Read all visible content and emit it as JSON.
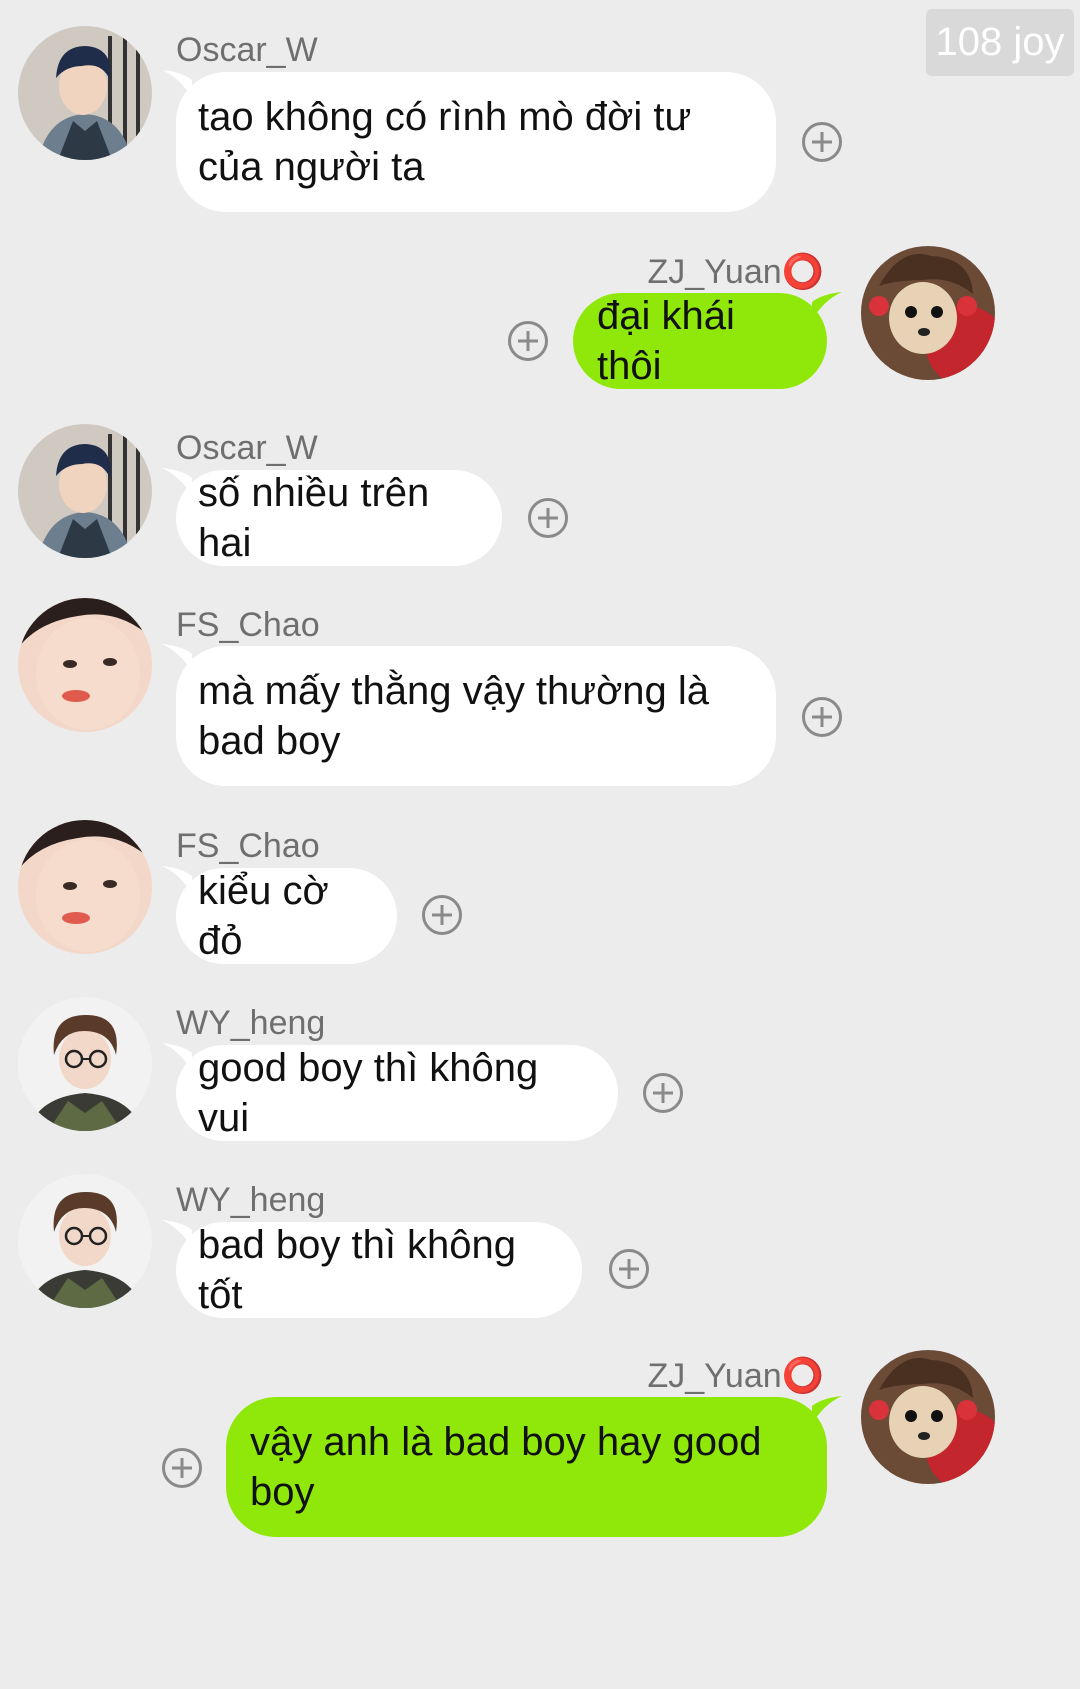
{
  "badge": {
    "text": "108 joy"
  },
  "messages": [
    {
      "sender": "Oscar_W",
      "side": "left",
      "avatar_icon": "oscar-avatar",
      "text": "tao không có rình mò đời tư của người ta"
    },
    {
      "sender": "ZJ_Yuan⭕",
      "side": "right",
      "avatar_icon": "dog-avatar",
      "text": "đại khái thôi"
    },
    {
      "sender": "Oscar_W",
      "side": "left",
      "avatar_icon": "oscar-avatar",
      "text": "số nhiều trên hai"
    },
    {
      "sender": "FS_Chao",
      "side": "left",
      "avatar_icon": "chao-avatar",
      "text": "mà mấy thằng vậy thường là bad boy"
    },
    {
      "sender": "FS_Chao",
      "side": "left",
      "avatar_icon": "chao-avatar",
      "text": "kiểu cờ đỏ"
    },
    {
      "sender": "WY_heng",
      "side": "left",
      "avatar_icon": "heng-avatar",
      "text": "good boy thì không vui"
    },
    {
      "sender": "WY_heng",
      "side": "left",
      "avatar_icon": "heng-avatar",
      "text": "bad boy thì không tốt"
    },
    {
      "sender": "ZJ_Yuan⭕",
      "side": "right",
      "avatar_icon": "dog-avatar",
      "text": "vậy anh là bad boy hay good boy"
    }
  ],
  "colors": {
    "background": "#ececec",
    "bubble_self": "#8fe80a",
    "bubble_other": "#ffffff",
    "username": "#6f6f6f",
    "badge": "#d9d9d9"
  }
}
